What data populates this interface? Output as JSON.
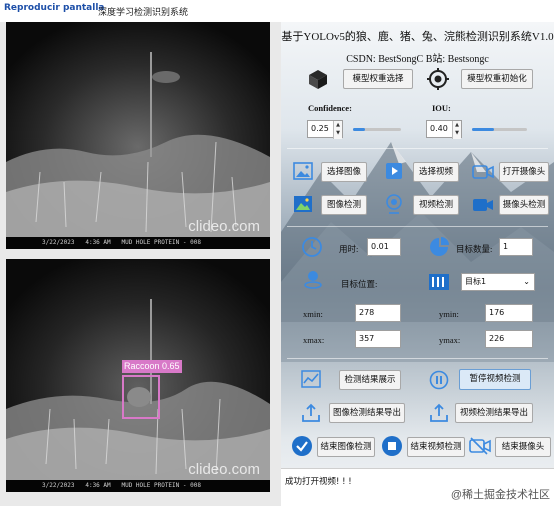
{
  "window": {
    "watermark_text": "Reproducir pantalla",
    "title": "深度学习检测识别系统"
  },
  "video_top": {
    "timestamp": "3/22/2023   4:36 AM   MUD HOLE PROTEIN - 008",
    "watermark": "clideo.com"
  },
  "video_bottom": {
    "timestamp": "3/22/2023   4:36 AM   MUD HOLE PROTEIN - 008",
    "watermark": "clideo.com",
    "detection_label": "Raccoon 0.65",
    "detection_color": "#d879c8"
  },
  "panel": {
    "title": "基于YOLOv5的狼、鹿、猪、兔、浣熊检测识别系统V1.0",
    "subtitle": "CSDN: BestSongC   B站: Bestsongc",
    "select_model_btn": "模型权重选择",
    "init_model_btn": "模型权重初始化",
    "confidence_label": "Confidence:",
    "confidence_value": "0.25",
    "confidence_level": 0.25,
    "iou_label": "IOU:",
    "iou_value": "0.40",
    "iou_level": 0.4,
    "select_image_btn": "选择图像",
    "select_video_btn": "选择视频",
    "open_camera_btn": "打开摄像头",
    "image_detect_btn": "图像检测",
    "video_detect_btn": "视频检测",
    "camera_detect_btn": "摄像头检测",
    "time_label": "用时:",
    "time_value": "0.01",
    "target_count_label": "目标数量:",
    "target_count_value": "1",
    "target_pos_label": "目标位置:",
    "target_select": "目标1",
    "xmin_label": "xmin:",
    "xmin_value": "278",
    "ymin_label": "ymin:",
    "ymin_value": "176",
    "xmax_label": "xmax:",
    "xmax_value": "357",
    "ymax_label": "ymax:",
    "ymax_value": "226",
    "show_result_btn": "检测结果展示",
    "pause_video_btn": "暂停视频检测",
    "export_image_btn": "图像检测结果导出",
    "export_video_btn": "视频检测结果导出",
    "end_image_btn": "结束图像检测",
    "end_video_btn": "结束视频检测",
    "end_camera_btn": "结束摄像头",
    "status_text": "成功打开视频! ! !",
    "footer": "@稀土掘金技术社区",
    "accent": "#3c8ae0"
  }
}
